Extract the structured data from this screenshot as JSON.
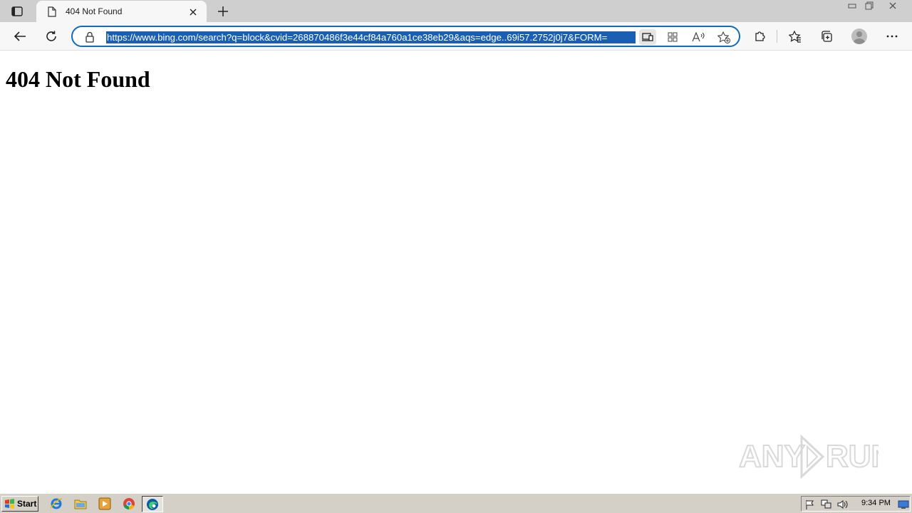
{
  "browser": {
    "tab": {
      "title": "404 Not Found",
      "favicon": "page-icon"
    },
    "new_tab_icon": "plus-icon",
    "address_bar": {
      "url": "https://www.bing.com/search?q=block&cvid=268870486f3e44cf84a760a1ce38eb29&aqs=edge..69i57.2752j0j7&FORM=",
      "selected": true
    },
    "toolbar_icons": [
      "back-icon",
      "refresh-icon",
      "lock-icon",
      "app-available-icon",
      "grid-icon",
      "read-aloud-icon",
      "add-favorite-icon",
      "extensions-icon",
      "favorites-icon",
      "collections-icon",
      "profile-icon",
      "more-icon"
    ],
    "accent_color": "#0f6cbd",
    "selection_color": "#1a5fb4"
  },
  "page": {
    "heading": "404 Not Found"
  },
  "watermark": {
    "text": "ANY RUN"
  },
  "taskbar": {
    "start_label": "Start",
    "pinned": [
      "internet-explorer-icon",
      "folder-icon",
      "media-player-icon",
      "chrome-icon",
      "edge-icon"
    ],
    "active": "edge-icon",
    "tray_icons": [
      "flag-icon",
      "network-icon",
      "volume-icon"
    ],
    "clock": "9:34 PM",
    "show_desktop_icon": "desktop-icon"
  }
}
